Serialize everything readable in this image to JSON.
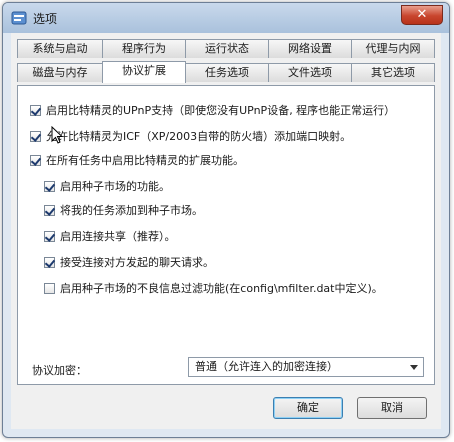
{
  "window": {
    "title": "选项"
  },
  "tabs_row1": [
    {
      "label": "系统与启动"
    },
    {
      "label": "程序行为"
    },
    {
      "label": "运行状态"
    },
    {
      "label": "网络设置"
    },
    {
      "label": "代理与内网"
    }
  ],
  "tabs_row2": [
    {
      "label": "磁盘与内存"
    },
    {
      "label": "协议扩展",
      "active": true
    },
    {
      "label": "任务选项"
    },
    {
      "label": "文件选项"
    },
    {
      "label": "其它选项"
    }
  ],
  "options": [
    {
      "label": "启用比特精灵的UPnP支持（即使您没有UPnP设备, 程序也能正常运行）",
      "checked": true
    },
    {
      "label": "允许比特精灵为ICF（XP/2003自带的防火墙）添加端口映射。",
      "checked": true
    },
    {
      "label": "在所有任务中启用比特精灵的扩展功能。",
      "checked": true
    },
    {
      "label": "启用种子市场的功能。",
      "checked": true
    },
    {
      "label": "将我的任务添加到种子市场。",
      "checked": true
    },
    {
      "label": "启用连接共享（推荐）。",
      "checked": true
    },
    {
      "label": "接受连接对方发起的聊天请求。",
      "checked": true
    },
    {
      "label": "启用种子市场的不良信息过滤功能(在config\\mfilter.dat中定义)。",
      "checked": false
    }
  ],
  "encryption": {
    "label": "协议加密：",
    "value": "普通（允许连入的加密连接）"
  },
  "buttons": {
    "ok": "确定",
    "cancel": "取消"
  }
}
